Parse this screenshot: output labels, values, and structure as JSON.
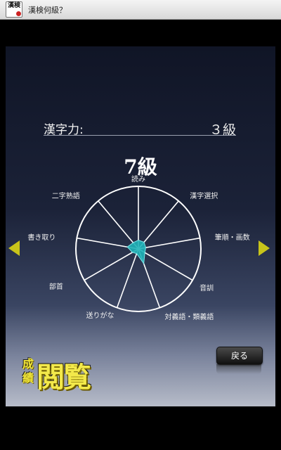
{
  "statusbar": {
    "app_icon_text": "漢検",
    "title": "漢検何級？"
  },
  "panel": {
    "kanji_label": "漢字力:",
    "kanji_value": "３級",
    "level": "7級",
    "back_label": "戻る",
    "logo_small": "成績",
    "logo_big": "閲覧"
  },
  "colors": {
    "accent_arrow": "#c8c41a",
    "chart_fill": "#1fb3b8",
    "chart_stroke": "#ffffff",
    "logo": "#f3e94a"
  },
  "icons": {
    "left": "triangle-left-icon",
    "right": "triangle-right-icon"
  },
  "chart_data": {
    "type": "radar",
    "categories": [
      "読み",
      "漢字選択",
      "筆順・画数",
      "音訓",
      "対義語・類義語",
      "送りがな",
      "部首",
      "書き取り",
      "二字熟語"
    ],
    "values": [
      0.14,
      0.14,
      0.12,
      0.12,
      0.25,
      0.08,
      0.11,
      0.18,
      0.13
    ],
    "range": [
      0,
      1
    ]
  }
}
